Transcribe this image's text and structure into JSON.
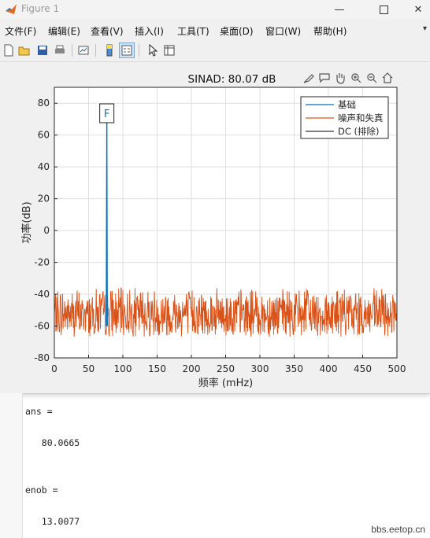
{
  "window": {
    "title": "Figure 1"
  },
  "menu": [
    "文件(F)",
    "编辑(E)",
    "查看(V)",
    "插入(I)",
    "工具(T)",
    "桌面(D)",
    "窗口(W)",
    "帮助(H)"
  ],
  "toolbar_icons": [
    "new-figure-icon",
    "open-file-icon",
    "save-icon",
    "print-icon",
    "link-plot-icon",
    "colorbar-icon",
    "legend-icon",
    "select-cursor-icon",
    "property-inspector-icon"
  ],
  "axes_toolbar_icons": [
    "brush-icon",
    "data-tips-icon",
    "pan-hand-icon",
    "zoom-in-icon",
    "zoom-out-icon",
    "home-icon"
  ],
  "chart_data": {
    "type": "line",
    "title": "SINAD:  80.07 dB",
    "xlabel": "频率 (mHz)",
    "ylabel": "功率(dB)",
    "xlim": [
      0,
      500
    ],
    "ylim": [
      -80,
      90
    ],
    "xticks": [
      "0",
      "50",
      "100",
      "150",
      "200",
      "250",
      "300",
      "350",
      "400",
      "450",
      "500"
    ],
    "yticks": [
      "-80",
      "-60",
      "-40",
      "-20",
      "0",
      "20",
      "40",
      "60",
      "80"
    ],
    "grid": true,
    "legend_position": "top-right",
    "annotation": "F",
    "series": [
      {
        "name": "基础",
        "color": "#0072bd",
        "points": [
          [
            75.8,
            -60
          ],
          [
            76.6,
            68.5
          ],
          [
            77.3,
            -60
          ]
        ]
      },
      {
        "name": "噪声和失真",
        "color": "#d95319",
        "noise_band": [
          -73,
          -36
        ]
      },
      {
        "name": "DC (排除)",
        "color": "#333333",
        "points": []
      }
    ]
  },
  "console": [
    {
      "text": "ans ="
    },
    {
      "text": "   80.0665"
    },
    {
      "text": "enob ="
    },
    {
      "text": "   13.0077"
    }
  ],
  "watermark": "bbs.eetop.cn",
  "colors": {
    "fundamental": "#0072bd",
    "noise": "#d95319",
    "dc": "#333333"
  }
}
